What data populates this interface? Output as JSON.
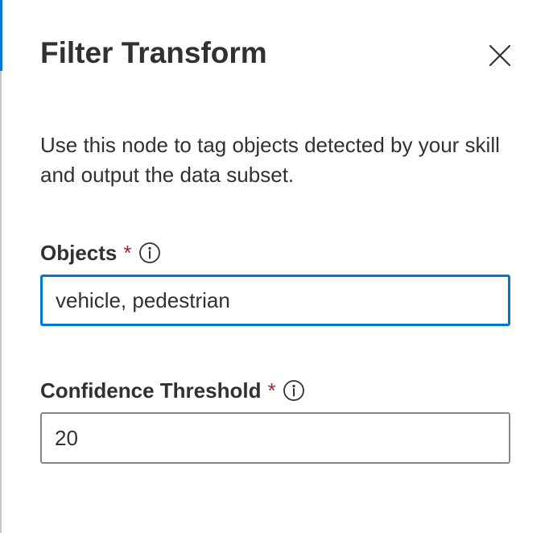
{
  "panel": {
    "title": "Filter Transform",
    "description": "Use this node to tag objects detected by your skill and output the data subset.",
    "close_icon": "close-icon"
  },
  "fields": {
    "objects": {
      "label": "Objects",
      "required_marker": "*",
      "info_icon": "info-icon",
      "value": "vehicle, pedestrian",
      "focused": true
    },
    "confidence_threshold": {
      "label": "Confidence Threshold",
      "required_marker": "*",
      "info_icon": "info-icon",
      "value": "20"
    }
  },
  "colors": {
    "accent": "#0078d4",
    "required": "#a4262c",
    "text": "#323130",
    "border": "#8a8886"
  }
}
